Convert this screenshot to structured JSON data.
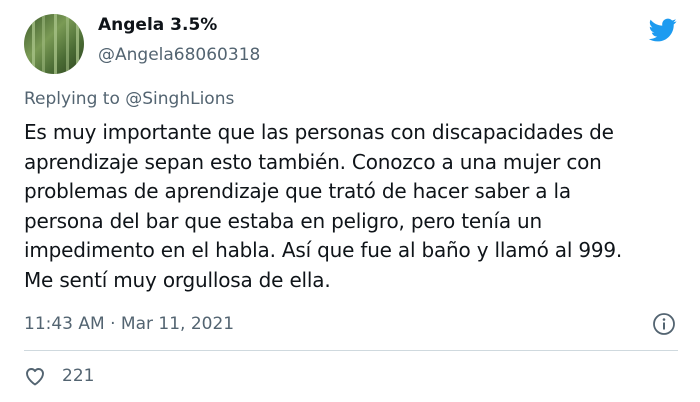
{
  "author": {
    "name": "Angela 3.5%",
    "handle": "@Angela68060318"
  },
  "reply": {
    "prefix": "Replying to ",
    "target": "@SinghLions"
  },
  "tweet": {
    "text": "Es muy importante que las personas con discapacidades de\naprendizaje sepan esto también. Conozco a una mujer con\nproblemas de aprendizaje que trató de hacer saber a la\npersona del bar que estaba en peligro, pero tenía un\nimpedimento en el habla. Así que fue al baño y llamó al 999.\nMe sentí muy orgullosa de ella.",
    "timestamp": "11:43 AM · Mar 11, 2021"
  },
  "engagement": {
    "likes": "221"
  },
  "icons": {
    "brand": "twitter-bird-icon",
    "info": "info-icon",
    "like": "heart-icon"
  },
  "colors": {
    "brand": "#1d9bf0",
    "muted": "#536471",
    "text": "#0f1419"
  }
}
